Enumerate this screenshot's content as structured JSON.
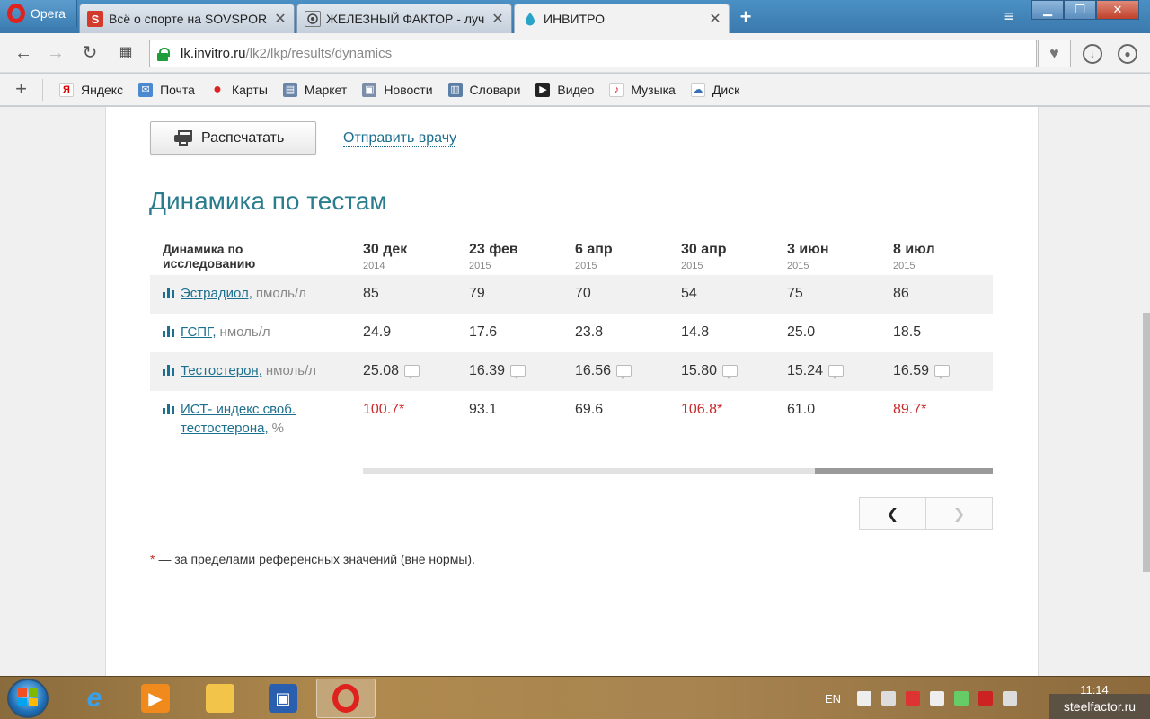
{
  "browser": {
    "menu_label": "Opera",
    "tabs": [
      {
        "title": "Всё о спорте на SOVSPOR",
        "favicon": "S"
      },
      {
        "title": "ЖЕЛЕЗНЫЙ ФАКТОР - луч",
        "favicon": "iron-factor-logo"
      },
      {
        "title": "ИНВИТРО",
        "favicon": "invitro-drop",
        "active": true
      }
    ],
    "url_host": "lk.invitro.ru",
    "url_path": "/lk2/lkp/results/dynamics",
    "bookmarks": [
      "Яндекс",
      "Почта",
      "Карты",
      "Маркет",
      "Новости",
      "Словари",
      "Видео",
      "Музыка",
      "Диск"
    ]
  },
  "page": {
    "print_label": "Распечатать",
    "send_label": "Отправить врачу",
    "title": "Динамика по тестам",
    "table": {
      "header_label_line1": "Динамика по",
      "header_label_line2": "исследованию",
      "columns": [
        {
          "date": "30 дек",
          "year": "2014"
        },
        {
          "date": "23 фев",
          "year": "2015"
        },
        {
          "date": "6 апр",
          "year": "2015"
        },
        {
          "date": "30 апр",
          "year": "2015"
        },
        {
          "date": "3 июн",
          "year": "2015"
        },
        {
          "date": "8 июл",
          "year": "2015"
        }
      ],
      "rows": [
        {
          "name": "Эстрадиол,",
          "unit": "пмоль/л",
          "values": [
            "85",
            "79",
            "70",
            "54",
            "75",
            "86"
          ]
        },
        {
          "name": "ГСПГ,",
          "unit": "нмоль/л",
          "values": [
            "24.9",
            "17.6",
            "23.8",
            "14.8",
            "25.0",
            "18.5"
          ]
        },
        {
          "name": "Тестостерон,",
          "unit": "нмоль/л",
          "values": [
            "25.08",
            "16.39",
            "16.56",
            "15.80",
            "15.24",
            "16.59"
          ],
          "has_comments": true
        },
        {
          "name_line1": "ИСТ- индекс своб.",
          "name_line2": "тестостерона,",
          "unit": "%",
          "values": [
            "100.7*",
            "93.1",
            "69.6",
            "106.8*",
            "61.0",
            "89.7*"
          ],
          "out_of_range": [
            true,
            false,
            false,
            true,
            false,
            true
          ]
        }
      ]
    },
    "pager": {
      "prev": "❮",
      "next": "❯"
    },
    "footnote_star": "*",
    "footnote_text": "— за пределами референсных значений (вне нормы)."
  },
  "taskbar": {
    "language": "EN",
    "time": "11:14",
    "watermark": "steelfactor.ru"
  },
  "colors": {
    "accent": "#2a7d8e",
    "link": "#1c6f8e",
    "out_of_range": "#c82a2a"
  }
}
